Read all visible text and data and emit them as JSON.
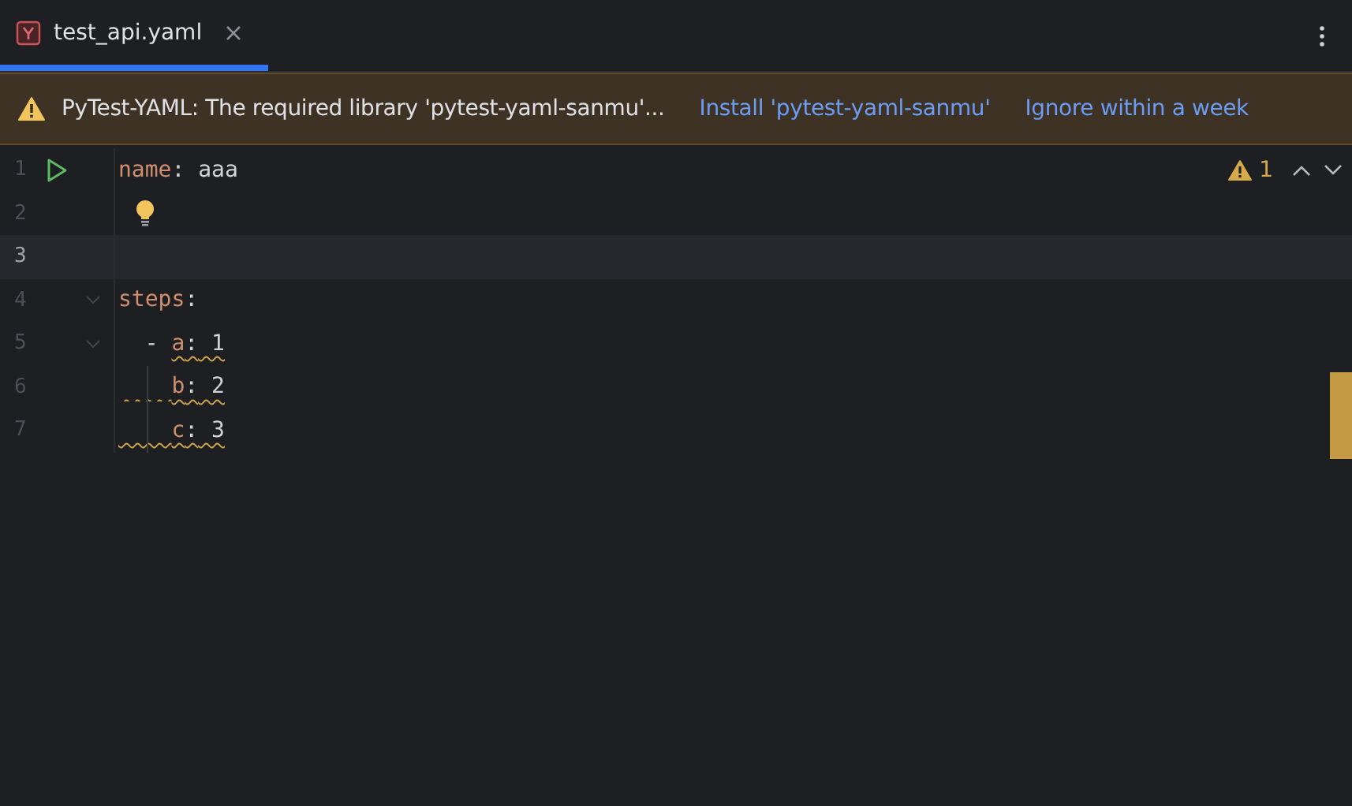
{
  "tabs": [
    {
      "label": "test_api.yaml",
      "selected": true
    }
  ],
  "banner": {
    "message": "PyTest-YAML: The required library 'pytest-yaml-sanmu'...",
    "actions": [
      "Install 'pytest-yaml-sanmu'",
      "Ignore within a week"
    ]
  },
  "inspections": {
    "warnings": "1"
  },
  "lines": [
    {
      "number": "1",
      "run": true,
      "fold": false,
      "bulb": false,
      "current": false,
      "warning": false,
      "key": "name",
      "sep": ":",
      "value": "aaa"
    },
    {
      "number": "2",
      "run": false,
      "fold": false,
      "bulb": true,
      "current": false,
      "warning": false
    },
    {
      "number": "3",
      "run": false,
      "fold": false,
      "bulb": false,
      "current": true,
      "warning": false
    },
    {
      "number": "4",
      "run": false,
      "fold": true,
      "bulb": false,
      "current": false,
      "warning": false,
      "key": "steps",
      "sep": ":",
      "children": [
        {
          "number": "5",
          "run": false,
          "fold": true,
          "bulb": false,
          "current": false,
          "warning": true,
          "bullet": "-",
          "key": "a",
          "sep": ":",
          "value": "1"
        },
        {
          "number": "6",
          "run": false,
          "fold": false,
          "bulb": false,
          "current": false,
          "warning": true,
          "key": "b",
          "sep": ":",
          "value": "2"
        },
        {
          "number": "7",
          "run": false,
          "fold": false,
          "bulb": false,
          "current": false,
          "warning": true,
          "key": "c",
          "sep": ":",
          "value": "3"
        }
      ]
    }
  ]
}
